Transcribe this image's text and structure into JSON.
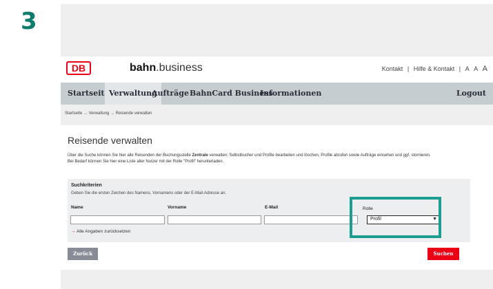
{
  "step": "3",
  "header": {
    "logo": "DB",
    "brand_bold": "bahn",
    "brand_rest": ".business",
    "links": [
      "Kontakt",
      "|",
      "Hilfe & Kontakt",
      "|",
      "A",
      "A",
      "A"
    ]
  },
  "nav": {
    "items": [
      "Startseite",
      "Verwaltung",
      "Aufträge",
      "BahnCard Business",
      "Informationen"
    ],
    "logout": "Logout"
  },
  "breadcrumb": "Startseite → Verwaltung → Reisende verwalten",
  "page": {
    "title": "Reisende verwalten",
    "desc_1": "Über die Suche können Sie hier alle Reisenden der Buchungsstelle ",
    "desc_bold": "Zentrale",
    "desc_2": " verwalten: Selbstbucher und Profile bearbeiten und löschen, Profile abrufen sowie Aufträge einsehen und ggf. stornieren.",
    "desc_3": "Bei Bedarf können Sie hier eine Liste aller Nutzer mit der Rolle \"Profil\" herunterladen."
  },
  "search": {
    "title": "Suchkriterien",
    "hint": "Geben Sie die ersten Zeichen des Namens, Vornamens oder der E-Mail-Adresse an.",
    "labels": {
      "name": "Name",
      "vorname": "Vorname",
      "email": "E-Mail",
      "rolle": "Rolle"
    },
    "values": {
      "name": "",
      "vorname": "",
      "email": ""
    },
    "role_value": "Profil",
    "reset": "Alle Angaben zurücksetzen"
  },
  "buttons": {
    "back": "Zurück",
    "search": "Suchen"
  },
  "colors": {
    "accent": "#1b9e91",
    "db_red": "#ec0016",
    "nav_bg": "#c6cdd1"
  }
}
